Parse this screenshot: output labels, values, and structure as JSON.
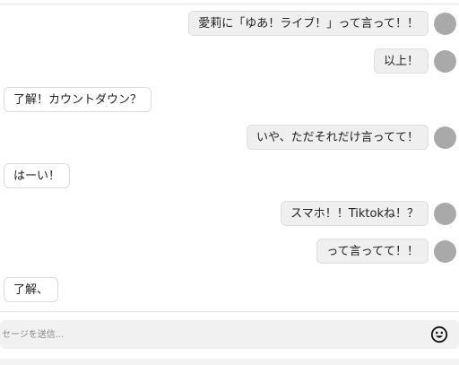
{
  "messages": [
    {
      "role": "user",
      "text": "愛莉に「ゆあ！ライブ！」って言って！！"
    },
    {
      "role": "user",
      "text": "以上！"
    },
    {
      "role": "assistant",
      "text": "了解！カウントダウン？"
    },
    {
      "role": "user",
      "text": "いや、ただそれだけ言ってて！"
    },
    {
      "role": "assistant",
      "text": "はーい！"
    },
    {
      "role": "user",
      "text": "スマホ！！Tiktokね！？"
    },
    {
      "role": "user",
      "text": "って言ってて！！"
    },
    {
      "role": "assistant",
      "text": "了解、"
    }
  ],
  "composer": {
    "placeholder": "セージを送信...",
    "value": "",
    "emoji_icon": "smiley-face-icon"
  },
  "colors": {
    "user_bubble": "#efefef",
    "assistant_bubble": "#ffffff",
    "avatar": "#a9a9a9",
    "input_bg": "#f1f1f1"
  }
}
